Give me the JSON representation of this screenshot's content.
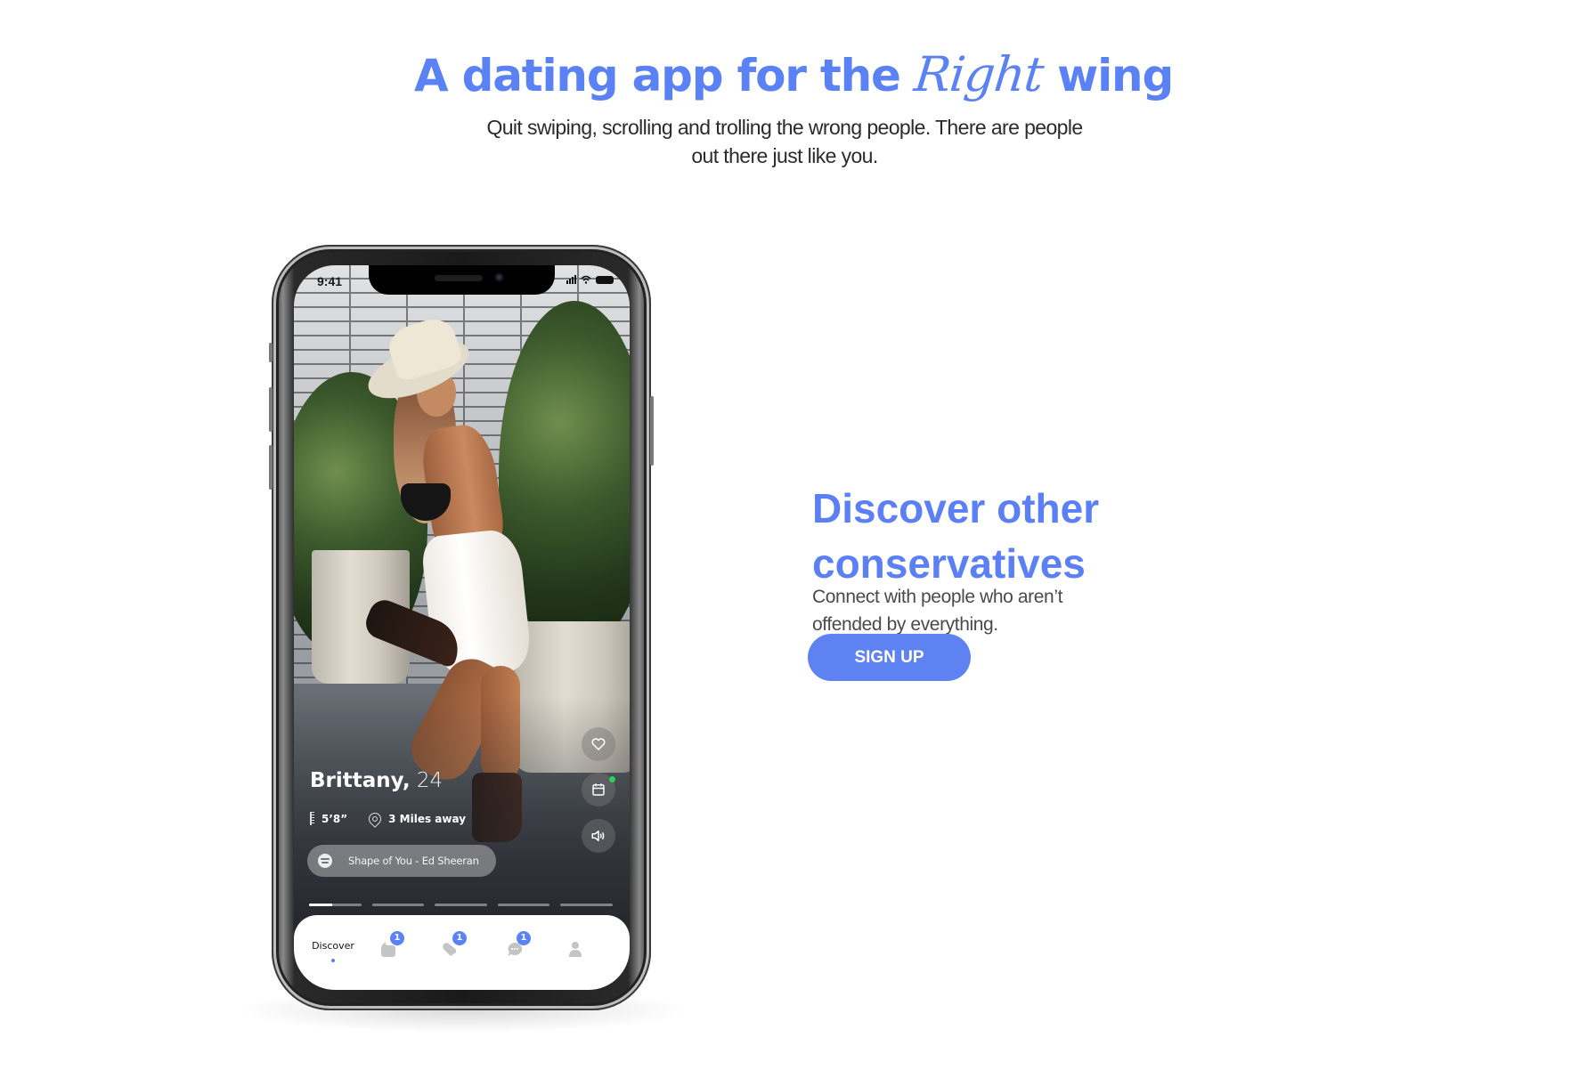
{
  "hero": {
    "title_prefix": "A dating app for the ",
    "title_script": "Right",
    "title_suffix": " wing",
    "subtitle": "Quit swiping, scrolling and trolling the wrong people. There are people out there just like you."
  },
  "phone": {
    "status_time": "9:41",
    "profile": {
      "name": "Brittany,",
      "age": "24",
      "height": "5’8”",
      "distance": "3 Miles away",
      "song": "Shape of You - Ed Sheeran"
    },
    "actions": [
      {
        "icon": "heart-icon"
      },
      {
        "icon": "calendar-icon",
        "online_indicator": true
      },
      {
        "icon": "speaker-icon"
      }
    ],
    "photo_progress": {
      "segments": 5,
      "current": 1,
      "current_fill": 0.45
    },
    "nav": [
      {
        "label": "Discover",
        "active": true
      },
      {
        "icon": "calendar-icon",
        "badge": "1"
      },
      {
        "icon": "heart-icon",
        "badge": "1"
      },
      {
        "icon": "chat-icon",
        "badge": "1"
      },
      {
        "icon": "profile-icon"
      }
    ]
  },
  "feature": {
    "title": "Discover other conservatives",
    "text": "Connect with people who aren’t offended by everything.",
    "cta_label": "SIGN UP"
  },
  "colors": {
    "accent": "#5b82f4",
    "button": "#5f82f3",
    "online": "#2bd15a"
  }
}
